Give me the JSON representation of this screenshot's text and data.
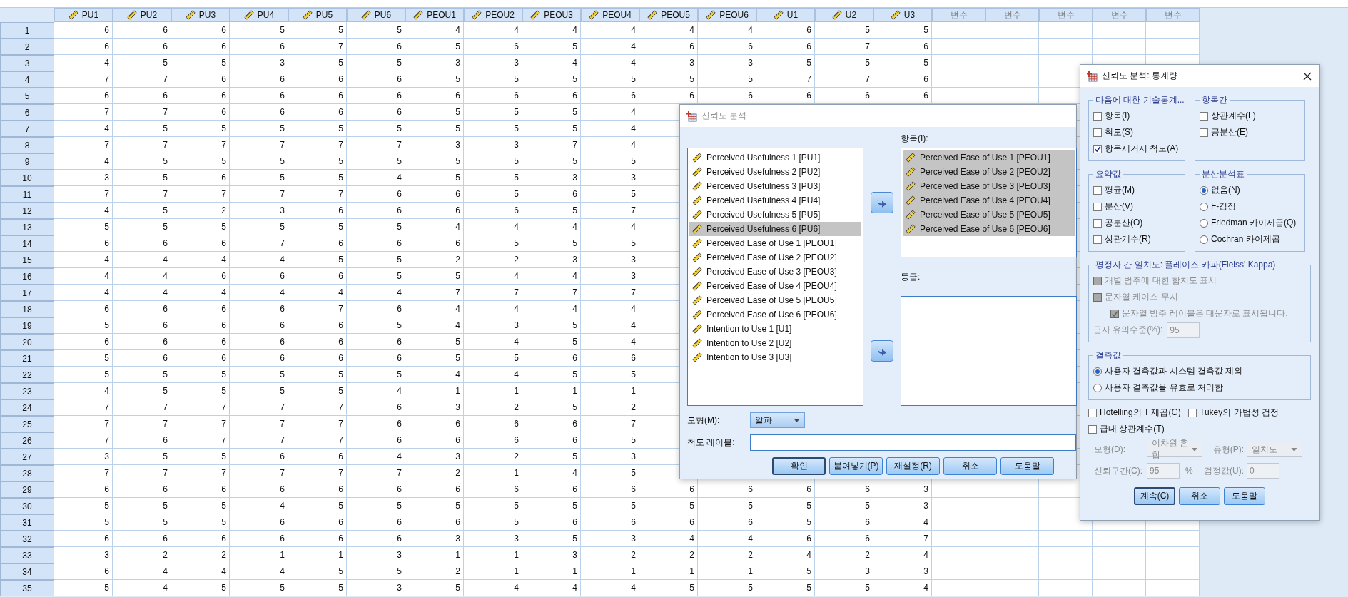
{
  "grid": {
    "columns": [
      {
        "label": "PU1",
        "kind": "scale"
      },
      {
        "label": "PU2",
        "kind": "scale"
      },
      {
        "label": "PU3",
        "kind": "scale"
      },
      {
        "label": "PU4",
        "kind": "scale"
      },
      {
        "label": "PU5",
        "kind": "scale"
      },
      {
        "label": "PU6",
        "kind": "scale"
      },
      {
        "label": "PEOU1",
        "kind": "scale"
      },
      {
        "label": "PEOU2",
        "kind": "scale"
      },
      {
        "label": "PEOU3",
        "kind": "scale"
      },
      {
        "label": "PEOU4",
        "kind": "scale"
      },
      {
        "label": "PEOU5",
        "kind": "scale"
      },
      {
        "label": "PEOU6",
        "kind": "scale"
      },
      {
        "label": "U1",
        "kind": "scale"
      },
      {
        "label": "U2",
        "kind": "scale"
      },
      {
        "label": "U3",
        "kind": "scale"
      },
      {
        "label": "변수",
        "kind": "empty"
      },
      {
        "label": "변수",
        "kind": "empty"
      },
      {
        "label": "변수",
        "kind": "empty"
      },
      {
        "label": "변수",
        "kind": "empty"
      },
      {
        "label": "변수",
        "kind": "empty"
      }
    ],
    "rows": [
      {
        "num": "1",
        "cells": [
          "6",
          "6",
          "6",
          "5",
          "5",
          "5",
          "4",
          "4",
          "4",
          "4",
          "4",
          "4",
          "6",
          "5",
          "5"
        ]
      },
      {
        "num": "2",
        "cells": [
          "6",
          "6",
          "6",
          "6",
          "7",
          "6",
          "5",
          "6",
          "5",
          "4",
          "6",
          "6",
          "6",
          "7",
          "6"
        ]
      },
      {
        "num": "3",
        "cells": [
          "4",
          "5",
          "5",
          "3",
          "5",
          "5",
          "3",
          "3",
          "4",
          "4",
          "3",
          "3",
          "5",
          "5",
          "5"
        ]
      },
      {
        "num": "4",
        "cells": [
          "7",
          "7",
          "6",
          "6",
          "6",
          "6",
          "5",
          "5",
          "5",
          "5",
          "5",
          "5",
          "7",
          "7",
          "6"
        ]
      },
      {
        "num": "5",
        "cells": [
          "6",
          "6",
          "6",
          "6",
          "6",
          "6",
          "6",
          "6",
          "6",
          "6",
          "6",
          "6",
          "6",
          "6",
          "6"
        ]
      },
      {
        "num": "6",
        "cells": [
          "7",
          "7",
          "6",
          "6",
          "6",
          "6",
          "5",
          "5",
          "5",
          "4"
        ]
      },
      {
        "num": "7",
        "cells": [
          "4",
          "5",
          "5",
          "5",
          "5",
          "5",
          "5",
          "5",
          "5",
          "4"
        ]
      },
      {
        "num": "8",
        "cells": [
          "7",
          "7",
          "7",
          "7",
          "7",
          "7",
          "3",
          "3",
          "7",
          "4"
        ]
      },
      {
        "num": "9",
        "cells": [
          "4",
          "5",
          "5",
          "5",
          "5",
          "5",
          "5",
          "5",
          "5",
          "5"
        ]
      },
      {
        "num": "10",
        "cells": [
          "3",
          "5",
          "6",
          "5",
          "5",
          "4",
          "5",
          "5",
          "3",
          "3"
        ]
      },
      {
        "num": "11",
        "cells": [
          "7",
          "7",
          "7",
          "7",
          "7",
          "6",
          "6",
          "5",
          "6",
          "5"
        ]
      },
      {
        "num": "12",
        "cells": [
          "4",
          "5",
          "2",
          "3",
          "6",
          "6",
          "6",
          "6",
          "5",
          "7"
        ]
      },
      {
        "num": "13",
        "cells": [
          "5",
          "5",
          "5",
          "5",
          "5",
          "5",
          "4",
          "4",
          "4",
          "4"
        ]
      },
      {
        "num": "14",
        "cells": [
          "6",
          "6",
          "6",
          "7",
          "6",
          "6",
          "6",
          "5",
          "5",
          "5"
        ]
      },
      {
        "num": "15",
        "cells": [
          "4",
          "4",
          "4",
          "4",
          "5",
          "5",
          "2",
          "2",
          "3",
          "3"
        ]
      },
      {
        "num": "16",
        "cells": [
          "4",
          "4",
          "6",
          "6",
          "6",
          "5",
          "5",
          "4",
          "4",
          "3"
        ]
      },
      {
        "num": "17",
        "cells": [
          "4",
          "4",
          "4",
          "4",
          "4",
          "4",
          "7",
          "7",
          "7",
          "7"
        ]
      },
      {
        "num": "18",
        "cells": [
          "6",
          "6",
          "6",
          "6",
          "7",
          "6",
          "4",
          "4",
          "4",
          "4"
        ]
      },
      {
        "num": "19",
        "cells": [
          "5",
          "6",
          "6",
          "6",
          "6",
          "5",
          "4",
          "3",
          "5",
          "4"
        ]
      },
      {
        "num": "20",
        "cells": [
          "6",
          "6",
          "6",
          "6",
          "6",
          "6",
          "5",
          "4",
          "5",
          "4"
        ]
      },
      {
        "num": "21",
        "cells": [
          "5",
          "6",
          "6",
          "6",
          "6",
          "6",
          "5",
          "5",
          "6",
          "6"
        ]
      },
      {
        "num": "22",
        "cells": [
          "5",
          "5",
          "5",
          "5",
          "5",
          "5",
          "4",
          "4",
          "5",
          "5"
        ]
      },
      {
        "num": "23",
        "cells": [
          "4",
          "5",
          "5",
          "5",
          "5",
          "4",
          "1",
          "1",
          "1",
          "1"
        ]
      },
      {
        "num": "24",
        "cells": [
          "7",
          "7",
          "7",
          "7",
          "7",
          "6",
          "3",
          "2",
          "5",
          "2"
        ]
      },
      {
        "num": "25",
        "cells": [
          "7",
          "7",
          "7",
          "7",
          "7",
          "6",
          "6",
          "6",
          "6",
          "7"
        ]
      },
      {
        "num": "26",
        "cells": [
          "7",
          "6",
          "7",
          "7",
          "7",
          "6",
          "6",
          "6",
          "6",
          "5"
        ]
      },
      {
        "num": "27",
        "cells": [
          "3",
          "5",
          "5",
          "6",
          "6",
          "4",
          "3",
          "2",
          "5",
          "3"
        ]
      },
      {
        "num": "28",
        "cells": [
          "7",
          "7",
          "7",
          "7",
          "7",
          "7",
          "2",
          "1",
          "4",
          "5"
        ]
      },
      {
        "num": "29",
        "cells": [
          "6",
          "6",
          "6",
          "6",
          "6",
          "6",
          "6",
          "6",
          "6",
          "6",
          "6",
          "6",
          "6",
          "6",
          "3"
        ]
      },
      {
        "num": "30",
        "cells": [
          "5",
          "5",
          "5",
          "4",
          "5",
          "5",
          "5",
          "5",
          "5",
          "5",
          "5",
          "5",
          "5",
          "5",
          "3"
        ]
      },
      {
        "num": "31",
        "cells": [
          "5",
          "5",
          "5",
          "6",
          "6",
          "6",
          "6",
          "5",
          "6",
          "6",
          "6",
          "6",
          "5",
          "6",
          "4"
        ]
      },
      {
        "num": "32",
        "cells": [
          "6",
          "6",
          "6",
          "6",
          "6",
          "6",
          "3",
          "3",
          "5",
          "3",
          "4",
          "4",
          "6",
          "6",
          "7"
        ]
      },
      {
        "num": "33",
        "cells": [
          "3",
          "2",
          "2",
          "1",
          "1",
          "3",
          "1",
          "1",
          "3",
          "2",
          "2",
          "2",
          "4",
          "2",
          "4"
        ]
      },
      {
        "num": "34",
        "cells": [
          "6",
          "4",
          "4",
          "4",
          "5",
          "5",
          "2",
          "1",
          "1",
          "1",
          "1",
          "1",
          "5",
          "3",
          "3"
        ]
      },
      {
        "num": "35",
        "cells": [
          "5",
          "4",
          "5",
          "5",
          "5",
          "3",
          "5",
          "4",
          "4",
          "4",
          "5",
          "5",
          "5",
          "5",
          "4"
        ]
      }
    ]
  },
  "reliability_dialog": {
    "title": "신뢰도 분석",
    "active": false,
    "variables": [
      {
        "label": "Perceived Usefulness 1 [PU1]",
        "selected": false
      },
      {
        "label": "Perceived Usefulness 2 [PU2]",
        "selected": false
      },
      {
        "label": "Perceived Usefulness 3 [PU3]",
        "selected": false
      },
      {
        "label": "Perceived Usefulness 4 [PU4]",
        "selected": false
      },
      {
        "label": "Perceived Usefulness 5 [PU5]",
        "selected": false
      },
      {
        "label": "Perceived Usefulness 6 [PU6]",
        "selected": true
      },
      {
        "label": "Perceived Ease of Use 1 [PEOU1]",
        "selected": false
      },
      {
        "label": "Perceived Ease of Use 2 [PEOU2]",
        "selected": false
      },
      {
        "label": "Perceived Ease of Use 3 [PEOU3]",
        "selected": false
      },
      {
        "label": "Perceived Ease of Use 4 [PEOU4]",
        "selected": false
      },
      {
        "label": "Perceived Ease of Use 5 [PEOU5]",
        "selected": false
      },
      {
        "label": "Perceived Ease of Use 6 [PEOU6]",
        "selected": false
      },
      {
        "label": "Intention to Use 1 [U1]",
        "selected": false
      },
      {
        "label": "Intention to Use 2 [U2]",
        "selected": false
      },
      {
        "label": "Intention to Use 3 [U3]",
        "selected": false
      }
    ],
    "items_label": "항목(I):",
    "items": [
      {
        "label": "Perceived Ease of Use 1 [PEOU1]",
        "selected": true
      },
      {
        "label": "Perceived Ease of Use 2 [PEOU2]",
        "selected": true
      },
      {
        "label": "Perceived Ease of Use 3 [PEOU3]",
        "selected": true
      },
      {
        "label": "Perceived Ease of Use 4 [PEOU4]",
        "selected": true
      },
      {
        "label": "Perceived Ease of Use 5 [PEOU5]",
        "selected": true
      },
      {
        "label": "Perceived Ease of Use 6 [PEOU6]",
        "selected": true
      }
    ],
    "ratings_label": "등급:",
    "model_label": "모형(M):",
    "model_value": "알파",
    "scale_label_label": "척도 레이블:",
    "buttons": [
      {
        "label": "확인",
        "default": true
      },
      {
        "label": "붙여넣기(P)",
        "default": false
      },
      {
        "label": "재설정(R)",
        "default": false
      },
      {
        "label": "취소",
        "default": false
      },
      {
        "label": "도움말",
        "default": false
      }
    ]
  },
  "statistics_dialog": {
    "title": "신뢰도 분석: 통계량",
    "active": true,
    "groups": [
      {
        "title": "다음에 대한 기술통계...",
        "options": [
          {
            "kind": "checkbox",
            "label": "항목(I)",
            "checked": false
          },
          {
            "kind": "checkbox",
            "label": "척도(S)",
            "checked": false
          },
          {
            "kind": "checkbox",
            "label": "항목제거시 척도(A)",
            "checked": true
          }
        ]
      },
      {
        "title": "항목간",
        "options": [
          {
            "kind": "checkbox",
            "label": "상관계수(L)",
            "checked": false
          },
          {
            "kind": "checkbox",
            "label": "공분산(E)",
            "checked": false
          }
        ]
      },
      {
        "title": "요약값",
        "options": [
          {
            "kind": "checkbox",
            "label": "평균(M)",
            "checked": false
          },
          {
            "kind": "checkbox",
            "label": "분산(V)",
            "checked": false
          },
          {
            "kind": "checkbox",
            "label": "공분산(O)",
            "checked": false
          },
          {
            "kind": "checkbox",
            "label": "상관계수(R)",
            "checked": false
          }
        ]
      },
      {
        "title": "분산분석표",
        "options": [
          {
            "kind": "radio",
            "label": "없음(N)",
            "selected": true
          },
          {
            "kind": "radio",
            "label": "F-검정",
            "selected": false
          },
          {
            "kind": "radio",
            "label": "Friedman 카이제곱(Q)",
            "selected": false
          },
          {
            "kind": "radio",
            "label": "Cochran 카이제곱",
            "selected": false
          }
        ]
      }
    ],
    "fleiss": {
      "title": "평정자 간 일치도: 플레이스 카파(Fleiss' Kappa)",
      "options": [
        {
          "label": "개별 범주에 대한 합치도 표시",
          "checked": false,
          "disabled": true
        },
        {
          "label": "문자열 케이스 무시",
          "checked": false,
          "disabled": true,
          "children": [
            {
              "label": "문자열 범주 레이블은 대문자로 표시됩니다.",
              "checked": true,
              "disabled": true
            }
          ]
        }
      ],
      "significance_label": "근사 유의수준(%):",
      "significance_value": "95"
    },
    "missing": {
      "title": "결측값",
      "options": [
        {
          "label": "사용자 결측값과 시스템 결측값 제외",
          "selected": true
        },
        {
          "label": "사용자 결측값을 유효로 처리함",
          "selected": false
        }
      ]
    },
    "extra_options": [
      {
        "label": "Hotelling의 T 제곱(G)",
        "checked": false
      },
      {
        "label": "Tukey의 가법성 검정",
        "checked": false
      },
      {
        "label": "급내 상관계수(T)",
        "checked": false
      }
    ],
    "icc": {
      "disabled": true,
      "model_label": "모형(D):",
      "model_value": "이차원 혼합",
      "type_label": "유형(P):",
      "type_value": "일치도",
      "ci_label": "신뢰구간(C):",
      "ci_value": "95",
      "ci_unit": "%",
      "test_label": "검정값(U):",
      "test_value": "0"
    },
    "buttons": [
      {
        "label": "계속(C)",
        "default": true
      },
      {
        "label": "취소",
        "default": false
      },
      {
        "label": "도움말",
        "default": false
      }
    ]
  }
}
